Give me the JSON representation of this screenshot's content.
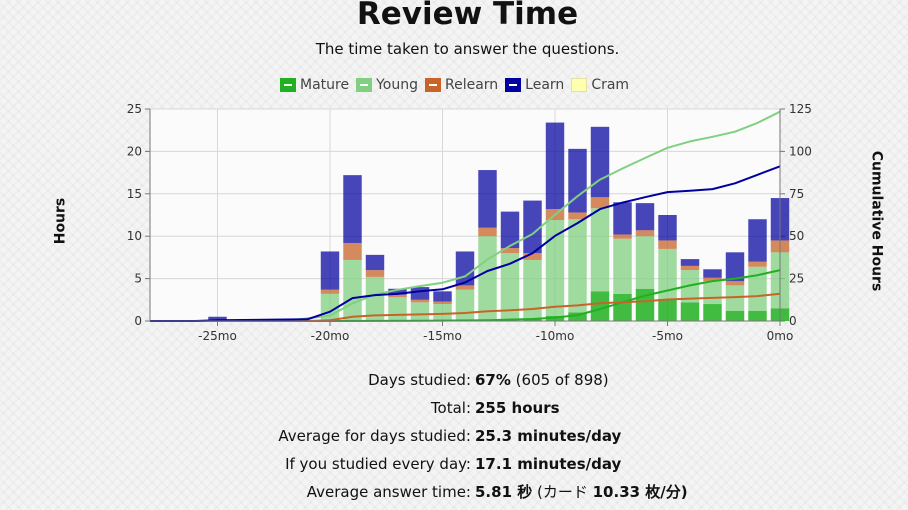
{
  "header": {
    "title": "Review Time",
    "subtitle": "The time taken to answer the questions."
  },
  "legend": [
    {
      "label": "Mature",
      "color": "#20b020",
      "mark": true
    },
    {
      "label": "Young",
      "color": "#80d080",
      "mark": true
    },
    {
      "label": "Relearn",
      "color": "#c86428",
      "mark": true
    },
    {
      "label": "Learn",
      "color": "#0000a0",
      "mark": true
    },
    {
      "label": "Cram",
      "color": "#ffffb0",
      "mark": false
    }
  ],
  "chart_data": {
    "type": "bar",
    "title": "Review Time",
    "subtitle": "The time taken to answer the questions.",
    "ylabel": "Hours",
    "y2label": "Cumulative Hours",
    "x_ticks": [
      "-25mo",
      "-20mo",
      "-15mo",
      "-10mo",
      "-5mo",
      "0mo"
    ],
    "y_ticks": [
      "0",
      "5",
      "10",
      "15",
      "20",
      "25"
    ],
    "y2_ticks": [
      "0",
      "25",
      "50",
      "75",
      "100",
      "125"
    ],
    "xlim": [
      -28,
      0
    ],
    "ylim": [
      0,
      25
    ],
    "y2lim": [
      0,
      125
    ],
    "grid": true,
    "legend_position": "top",
    "x": [
      -25,
      -20,
      -19,
      -18,
      -17,
      -16,
      -15,
      -14,
      -13,
      -12,
      -11,
      -10,
      -9,
      -8,
      -7,
      -6,
      -5,
      -4,
      -3,
      -2,
      -1,
      0
    ],
    "series": [
      {
        "name": "Mature",
        "color": "#20b020",
        "values": [
          0,
          0,
          0,
          0,
          0,
          0,
          0,
          0,
          0,
          0,
          0.2,
          0.6,
          1.0,
          3.5,
          3.2,
          3.8,
          2.5,
          2.2,
          2.0,
          1.2,
          1.2,
          1.5
        ]
      },
      {
        "name": "Young",
        "color": "#80d080",
        "values": [
          0,
          3.2,
          7.2,
          5.2,
          2.8,
          2.2,
          2.0,
          3.7,
          10.0,
          8.0,
          7.0,
          11.3,
          11.0,
          9.8,
          6.5,
          6.2,
          6.0,
          3.8,
          2.7,
          3.0,
          5.2,
          6.6
        ]
      },
      {
        "name": "Relearn",
        "color": "#c86428",
        "values": [
          0,
          0.5,
          2.0,
          0.8,
          0.3,
          0.3,
          0.3,
          0.5,
          1.0,
          0.6,
          0.8,
          1.3,
          0.8,
          1.3,
          0.5,
          0.7,
          1.0,
          0.5,
          0.4,
          0.5,
          0.6,
          1.4
        ]
      },
      {
        "name": "Learn",
        "color": "#0000a0",
        "values": [
          0.5,
          4.5,
          8.0,
          1.8,
          0.7,
          1.5,
          1.2,
          4.0,
          6.8,
          4.3,
          6.2,
          10.2,
          7.5,
          8.3,
          3.8,
          3.2,
          3.0,
          0.8,
          1.0,
          3.4,
          5.0,
          5.0
        ]
      }
    ],
    "cumulative": [
      {
        "name": "Mature",
        "color": "#20b020",
        "points": [
          [
            -28,
            0
          ],
          [
            -20,
            0
          ],
          [
            -16,
            0.2
          ],
          [
            -13,
            0.5
          ],
          [
            -11,
            1.2
          ],
          [
            -10,
            2
          ],
          [
            -9,
            3.5
          ],
          [
            -8,
            7
          ],
          [
            -7,
            11
          ],
          [
            -6,
            15
          ],
          [
            -5,
            18
          ],
          [
            -4,
            21
          ],
          [
            -3,
            23.5
          ],
          [
            -2,
            25
          ],
          [
            -1,
            27
          ],
          [
            0,
            30
          ]
        ]
      },
      {
        "name": "Young",
        "color": "#80d080",
        "points": [
          [
            -28,
            0
          ],
          [
            -22,
            0
          ],
          [
            -20,
            3.2
          ],
          [
            -19,
            10.4
          ],
          [
            -18,
            15.6
          ],
          [
            -17,
            18.4
          ],
          [
            -16,
            20.6
          ],
          [
            -15,
            22.6
          ],
          [
            -14,
            26.3
          ],
          [
            -13,
            36.3
          ],
          [
            -12,
            44.3
          ],
          [
            -11,
            51.3
          ],
          [
            -10,
            62.6
          ],
          [
            -9,
            73.6
          ],
          [
            -8,
            83.4
          ],
          [
            -7,
            89.9
          ],
          [
            -6,
            96.1
          ],
          [
            -5,
            102.1
          ],
          [
            -4,
            105.9
          ],
          [
            -3,
            108.6
          ],
          [
            -2,
            111.6
          ],
          [
            -1,
            116.8
          ],
          [
            0,
            123.4
          ]
        ]
      },
      {
        "name": "Relearn",
        "color": "#c86428",
        "points": [
          [
            -28,
            0
          ],
          [
            -21,
            0
          ],
          [
            -20,
            0.5
          ],
          [
            -19,
            2.5
          ],
          [
            -18,
            3.3
          ],
          [
            -17,
            3.6
          ],
          [
            -16,
            3.9
          ],
          [
            -15,
            4.2
          ],
          [
            -14,
            4.7
          ],
          [
            -13,
            5.7
          ],
          [
            -12,
            6.3
          ],
          [
            -11,
            7.1
          ],
          [
            -10,
            8.4
          ],
          [
            -9,
            9.2
          ],
          [
            -8,
            10.5
          ],
          [
            -7,
            11
          ],
          [
            -6,
            11.7
          ],
          [
            -5,
            12.7
          ],
          [
            -4,
            13.2
          ],
          [
            -3,
            13.6
          ],
          [
            -2,
            14.1
          ],
          [
            -1,
            14.7
          ],
          [
            0,
            16.1
          ]
        ]
      },
      {
        "name": "Learn",
        "color": "#0000a0",
        "points": [
          [
            -28,
            0
          ],
          [
            -26,
            0
          ],
          [
            -25,
            0.5
          ],
          [
            -21,
            1
          ],
          [
            -20,
            5.5
          ],
          [
            -19,
            13.5
          ],
          [
            -18,
            15.3
          ],
          [
            -17,
            16
          ],
          [
            -16,
            17.5
          ],
          [
            -15,
            18.7
          ],
          [
            -14,
            22.7
          ],
          [
            -13,
            29.5
          ],
          [
            -12,
            33.8
          ],
          [
            -11,
            40
          ],
          [
            -10,
            50.2
          ],
          [
            -9,
            57.7
          ],
          [
            -8,
            66
          ],
          [
            -7,
            69.8
          ],
          [
            -6,
            73
          ],
          [
            -5,
            76
          ],
          [
            -4,
            76.8
          ],
          [
            -3,
            77.8
          ],
          [
            -2,
            81.2
          ],
          [
            -1,
            86.2
          ],
          [
            0,
            91.2
          ]
        ]
      }
    ]
  },
  "stats": [
    {
      "label": "Days studied:",
      "bold": "67%",
      "rest": " (605 of 898)",
      "tail": ""
    },
    {
      "label": "Total:",
      "bold": "255 hours",
      "rest": "",
      "tail": ""
    },
    {
      "label": "Average for days studied:",
      "bold": "25.3 minutes/day",
      "rest": "",
      "tail": ""
    },
    {
      "label": "If you studied every day:",
      "bold": "17.1 minutes/day",
      "rest": "",
      "tail": ""
    },
    {
      "label": "Average answer time:",
      "bold": "5.81 秒",
      "rest": " (カード ",
      "tail": "10.33 枚/分)"
    }
  ]
}
